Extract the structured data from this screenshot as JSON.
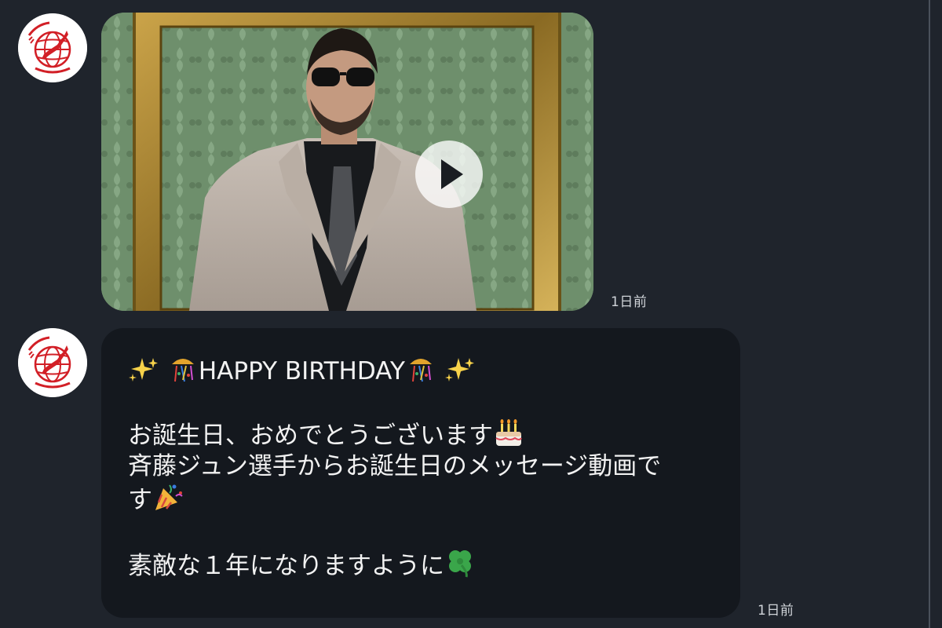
{
  "colors": {
    "background": "#1f242c",
    "bubble": "#14181e",
    "text": "#f2f2f2",
    "timestamp": "#cfd3d8",
    "logo_red": "#d21f26"
  },
  "messages": [
    {
      "type": "video",
      "sender_logo": "ALL JAPAN PRO-WRESTLING",
      "play_icon": "play-icon",
      "timestamp": "1日前"
    },
    {
      "type": "text",
      "sender_logo": "ALL JAPAN PRO-WRESTLING",
      "lines": [
        "HAPPY BIRTHDAY",
        "",
        "お誕生日、おめでとうございます",
        "斉藤ジュン選手からお誕生日のメッセージ動画で",
        "す",
        "",
        "素敵な１年になりますように"
      ],
      "emojis": [
        "sparkles-icon",
        "confetti-ball-icon",
        "birthday-cake-icon",
        "party-popper-icon",
        "four-leaf-clover-icon"
      ],
      "timestamp": "1日前"
    }
  ]
}
